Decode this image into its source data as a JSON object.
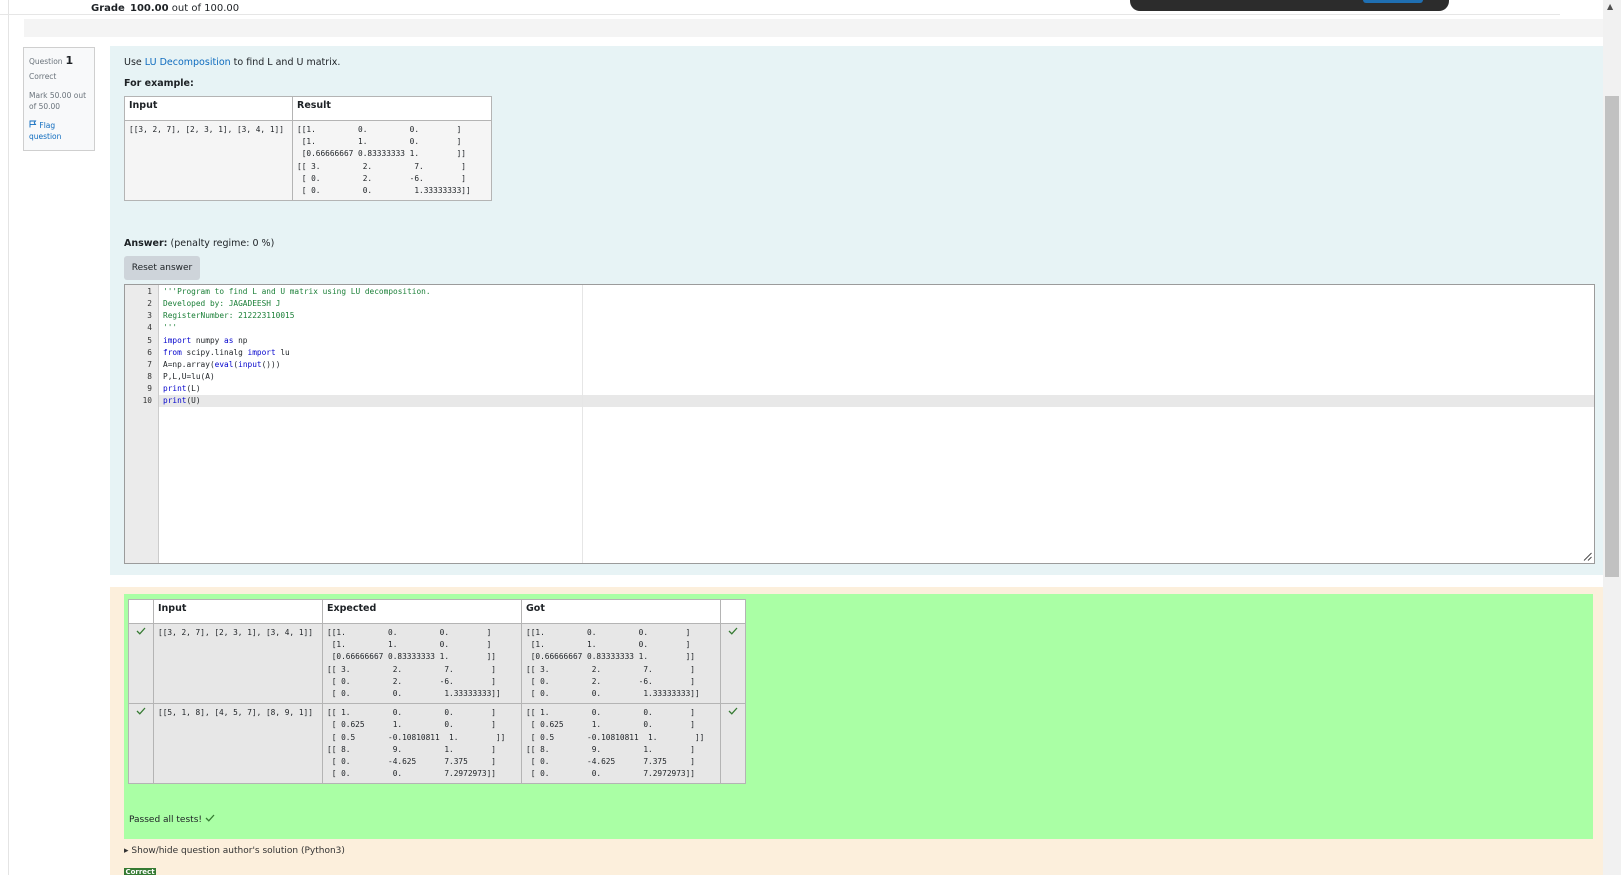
{
  "grade": {
    "label": "Grade",
    "value": "100.00",
    "suffix": " out of 100.00"
  },
  "question_info": {
    "label": "Question",
    "number": "1",
    "state": "Correct",
    "mark": "Mark 50.00 out of 50.00",
    "flag": "Flag question"
  },
  "question": {
    "text_pre": "Use ",
    "text_link": "LU Decomposition",
    "text_post": " to find L and U matrix.",
    "for_example": "For example:",
    "example_table": {
      "headers": [
        "Input",
        "Result"
      ],
      "rows": [
        {
          "input": "[[3, 2, 7], [2, 3, 1], [3, 4, 1]]",
          "result": "[[1.         0.         0.        ]\n [1.         1.         0.        ]\n [0.66666667 0.83333333 1.        ]]\n[[ 3.         2.         7.        ]\n [ 0.         2.        -6.        ]\n [ 0.         0.         1.33333333]]"
        }
      ]
    }
  },
  "answer": {
    "label": "Answer:",
    "penalty": "(penalty regime: 0 %)",
    "reset_button": "Reset answer",
    "line_numbers": [
      "1",
      "2",
      "3",
      "4",
      "5",
      "6",
      "7",
      "8",
      "9",
      "10"
    ]
  },
  "results_table": {
    "headers": [
      "",
      "Input",
      "Expected",
      "Got",
      ""
    ],
    "rows": [
      {
        "input": "[[3, 2, 7], [2, 3, 1], [3, 4, 1]]",
        "expected": "[[1.         0.         0.        ]\n [1.         1.         0.        ]\n [0.66666667 0.83333333 1.        ]]\n[[ 3.         2.         7.        ]\n [ 0.         2.        -6.        ]\n [ 0.         0.         1.33333333]]",
        "got": "[[1.         0.         0.        ]\n [1.         1.         0.        ]\n [0.66666667 0.83333333 1.        ]]\n[[ 3.         2.         7.        ]\n [ 0.         2.        -6.        ]\n [ 0.         0.         1.33333333]]"
      },
      {
        "input": "[[5, 1, 8], [4, 5, 7], [8, 9, 1]]",
        "expected": "[[ 1.         0.         0.        ]\n [ 0.625      1.         0.        ]\n [ 0.5       -0.10810811  1.        ]]\n[[ 8.         9.         1.        ]\n [ 0.        -4.625      7.375     ]\n [ 0.         0.         7.2972973]]",
        "got": "[[ 1.         0.         0.        ]\n [ 0.625      1.         0.        ]\n [ 0.5       -0.10810811  1.        ]]\n[[ 8.         9.         1.        ]\n [ 0.        -4.625      7.375     ]\n [ 0.         0.         7.2972973]]"
      }
    ]
  },
  "feedback": {
    "passed": "Passed all tests!",
    "show_hide": "Show/hide question author's solution (Python3)",
    "badge": "Correct"
  },
  "colors": {
    "question_bg": "#e7f3f5",
    "feedback_bg": "#fcefdc",
    "pass_green": "#aaffa5",
    "link_blue": "#0f6cbf",
    "check_green": "#357a32"
  }
}
